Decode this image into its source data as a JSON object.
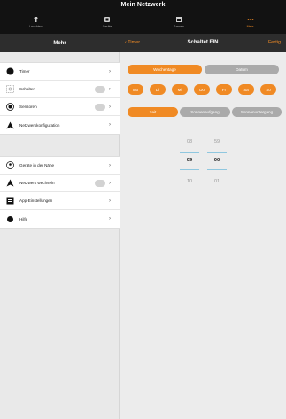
{
  "app": {
    "title": "Mein Netzwerk"
  },
  "tabs": [
    {
      "label": "Leuchten",
      "icon": "lamp-icon"
    },
    {
      "label": "Geräte",
      "icon": "device-icon"
    },
    {
      "label": "Szenen",
      "icon": "scene-icon"
    },
    {
      "label": "Mehr",
      "icon": "more-icon"
    }
  ],
  "left_header": {
    "title": "Mehr"
  },
  "right_header": {
    "back_label": "Timer",
    "title": "Schaltet EIN",
    "done_label": "Fertig"
  },
  "menu_group1": [
    {
      "label": "Timer",
      "icon": "timer-icon",
      "toggle": false
    },
    {
      "label": "Schalter",
      "icon": "switch-icon",
      "toggle": true
    },
    {
      "label": "Sensoren",
      "icon": "sensor-icon",
      "toggle": true
    },
    {
      "label": "Netzwerkkonfiguration",
      "icon": "network-icon",
      "toggle": false
    }
  ],
  "menu_group2": [
    {
      "label": "Geräte in der Nähe",
      "icon": "nearby-icon",
      "toggle": false
    },
    {
      "label": "Netzwerk wechseln",
      "icon": "network-switch-icon",
      "toggle": true
    },
    {
      "label": "App-Einstellungen",
      "icon": "settings-icon",
      "toggle": false
    },
    {
      "label": "Hilfe",
      "icon": "help-icon",
      "toggle": false
    }
  ],
  "mode_toggle": {
    "weekdays": "Wochentage",
    "date": "Datum",
    "selected": "weekdays"
  },
  "days": [
    "Mo",
    "Di",
    "Mi",
    "Do",
    "Fr",
    "Sa",
    "So"
  ],
  "time_mode": {
    "time": "Zeit",
    "sunrise": "Sonnenaufgang",
    "sunset": "Sonnenuntergang",
    "selected": "time"
  },
  "picker": {
    "hours": {
      "prev": "08",
      "current": "09",
      "next": "10"
    },
    "minutes": {
      "prev": "59",
      "current": "00",
      "next": "01"
    }
  },
  "colors": {
    "accent": "#f08a24",
    "header": "#2d2d2d",
    "topbar": "#121212",
    "inactive_pill": "#aaaaaa"
  }
}
